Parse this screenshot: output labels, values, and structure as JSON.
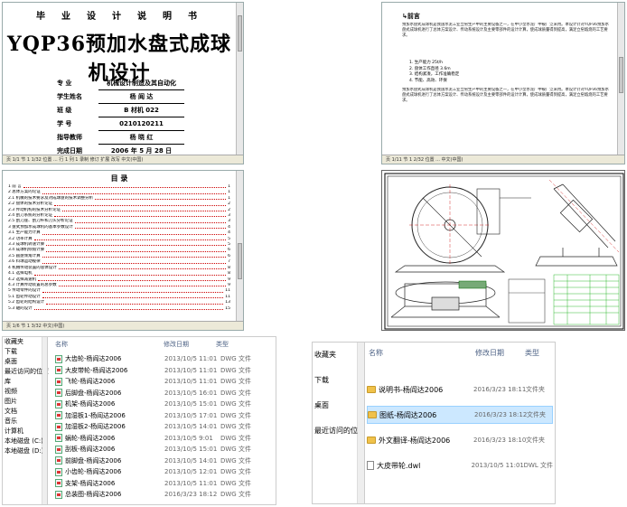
{
  "cover": {
    "header": "毕 业 设 计 说 明 书",
    "title": "YQP36预加水盘式成球机设计",
    "fields": [
      {
        "label": "专    业",
        "value": "机械设计制造及其自动化"
      },
      {
        "label": "学生姓名",
        "value": "杨 阎 达"
      },
      {
        "label": "班    级",
        "value": "B 材机 022"
      },
      {
        "label": "学    号",
        "value": "0210120211"
      },
      {
        "label": "指导教师",
        "value": "杨 晓 红"
      },
      {
        "label": "完成日期",
        "value": "2006 年 5 月 28 日"
      }
    ],
    "status": "页 1/1  节 1  1/32  位置 ...  行 1  列 1  录制  修订  扩展  改写  中文(中国)"
  },
  "preface": {
    "heading": "前言",
    "status": "页 1/11  节 1  2/32  位置 ...  中文(中国)",
    "text": "预加水盘式成球机是我国水泥工业立窑生产中的主要设备之一，在中小型水泥厂中被广泛采用。本设计针对YQP36预加水盘式成球机进行了总体方案设计、传动系统设计及主要零部件的设计计算，使成球质量得到提高，满足立窑煅烧的工艺要求。",
    "list": [
      "1. 生产能力 25t/h",
      "2. 盘体工作直径 3.6m",
      "3. 结构紧凑，工作准确稳定",
      "4. 节能、高效、环保"
    ]
  },
  "toc": {
    "heading": "目 录",
    "status": "页 1/6  节 1  3/32  中文(中国)",
    "items": [
      {
        "t": "1 前 言",
        "p": "1"
      },
      {
        "t": "2 总体方案的论证",
        "p": "1"
      },
      {
        "t": "2.1 机械的技术要求及对成球盘的技术调整分析",
        "p": "1"
      },
      {
        "t": "2.2 盘体的技术分析论证",
        "p": "2"
      },
      {
        "t": "2.3 传动机构的技术分析论证",
        "p": "2"
      },
      {
        "t": "2.4 刮刀系统的分析论证",
        "p": "3"
      },
      {
        "t": "2.5 刮刀座、刮刀杆和刀头分析论证",
        "p": "3"
      },
      {
        "t": "3 盘式预加水成球机的基本参数设计",
        "p": "4"
      },
      {
        "t": "3.1 生产能力计算",
        "p": "4"
      },
      {
        "t": "3.2 功率计算",
        "p": "5"
      },
      {
        "t": "3.3 成球机转速计算",
        "p": "5"
      },
      {
        "t": "3.4 成球机倾角计算",
        "p": "6"
      },
      {
        "t": "3.5 圆盘倾角计算",
        "p": "6"
      },
      {
        "t": "3.6 料球运动规律",
        "p": "7"
      },
      {
        "t": "4 机械传动装置的总体设计",
        "p": "8"
      },
      {
        "t": "4.1 选择电机",
        "p": "8"
      },
      {
        "t": "4.2 选择减速机",
        "p": "9"
      },
      {
        "t": "4.3 计算传动装置的总参数",
        "p": "9"
      },
      {
        "t": "5 传动零件的设计",
        "p": "11"
      },
      {
        "t": "5.1 齿轮传动设计",
        "p": "11"
      },
      {
        "t": "5.2 齿轮的结构设计",
        "p": "13"
      },
      {
        "t": "5.3 轴的设计",
        "p": "15"
      }
    ]
  },
  "explorer1": {
    "sidebar": [
      "收藏夹",
      "下载",
      "桌面",
      "最近访问的位置",
      "",
      "库",
      "视频",
      "图片",
      "文档",
      "音乐",
      "",
      "计算机",
      "本地磁盘 (C:)",
      "本地磁盘 (D:)"
    ],
    "columns": [
      "名称",
      "修改日期",
      "类型"
    ],
    "files": [
      {
        "name": "大齿轮-杨阎达2006",
        "date": "2013/10/5 11:01",
        "type": "DWG 文件"
      },
      {
        "name": "大皮带轮-杨阎达2006",
        "date": "2013/10/5 11:01",
        "type": "DWG 文件"
      },
      {
        "name": "飞轮-杨阎达2006",
        "date": "2013/10/5 11:01",
        "type": "DWG 文件"
      },
      {
        "name": "后脚盘-杨阎达2006",
        "date": "2013/10/5 16:01",
        "type": "DWG 文件"
      },
      {
        "name": "机架-杨阎达2006",
        "date": "2013/10/5 15:01",
        "type": "DWG 文件"
      },
      {
        "name": "加湿板1-杨阎达2006",
        "date": "2013/10/5 17:01",
        "type": "DWG 文件"
      },
      {
        "name": "加湿板2-杨阎达2006",
        "date": "2013/10/5 14:01",
        "type": "DWG 文件"
      },
      {
        "name": "蜗轮-杨阎达2006",
        "date": "2013/10/5 9:01",
        "type": "DWG 文件"
      },
      {
        "name": "刮板-杨阎达2006",
        "date": "2013/10/5 15:01",
        "type": "DWG 文件"
      },
      {
        "name": "前脚盘-杨阎达2006",
        "date": "2013/10/5 14:01",
        "type": "DWG 文件"
      },
      {
        "name": "小齿轮-杨阎达2006",
        "date": "2013/10/5 12:01",
        "type": "DWG 文件"
      },
      {
        "name": "支架-杨阎达2006",
        "date": "2013/10/5 11:01",
        "type": "DWG 文件"
      },
      {
        "name": "总装图-杨阎达2006",
        "date": "2016/3/23 18:12",
        "type": "DWG 文件"
      }
    ]
  },
  "explorer2": {
    "sidebar": [
      "收藏夹",
      "下载",
      "桌面",
      "最近访问的位置"
    ],
    "columns": [
      "名称",
      "修改日期",
      "类型"
    ],
    "files": [
      {
        "name": "说明书-杨阎达2006",
        "date": "2016/3/23 18:11",
        "type": "文件夹",
        "kind": "folder"
      },
      {
        "name": "图纸-杨阎达2006",
        "date": "2016/3/23 18:12",
        "type": "文件夹",
        "kind": "folder"
      },
      {
        "name": "外文翻译-杨阎达2006",
        "date": "2016/3/23 18:10",
        "type": "文件夹",
        "kind": "folder"
      },
      {
        "name": "大皮带轮.dwl",
        "date": "2013/10/5 11:01",
        "type": "DWL 文件",
        "kind": "dwl"
      }
    ]
  }
}
